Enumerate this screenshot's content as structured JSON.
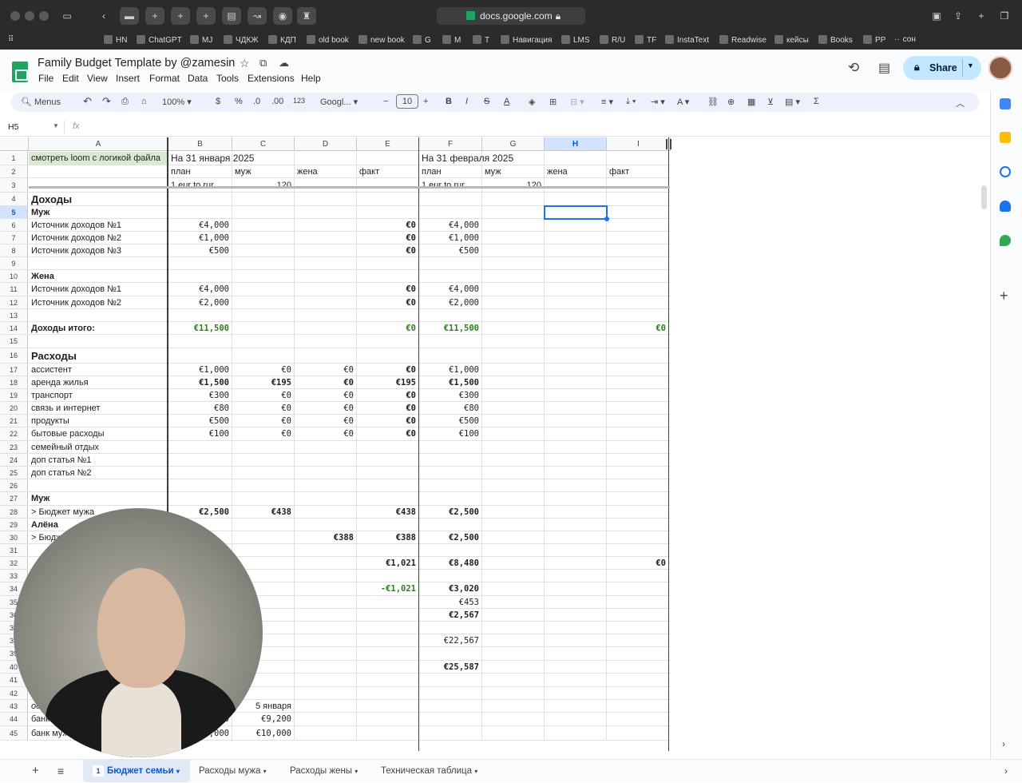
{
  "browser": {
    "url": "docs.google.com",
    "bookmarks": [
      "HN",
      "ChatGPT",
      "MJ",
      "ЧДКЖ",
      "КДП",
      "old book",
      "new book",
      "G",
      "M",
      "T",
      "Навигация",
      "LMS",
      "R/U",
      "TF",
      "InstaText",
      "Readwise",
      "кейсы",
      "Books",
      "PP",
      "сон"
    ]
  },
  "doc": {
    "title": "Family Budget Template by @zamesin",
    "menu": [
      "File",
      "Edit",
      "View",
      "Insert",
      "Format",
      "Data",
      "Tools",
      "Extensions",
      "Help"
    ],
    "share_label": "Share"
  },
  "toolbar": {
    "search": "Menus",
    "zoom": "100%",
    "currency": "$",
    "percent": "%",
    "dec_decrease": ".0",
    "dec_increase": ".00",
    "number_format": "123",
    "font": "Googl...",
    "font_size": "10",
    "bold": "B",
    "italic": "I",
    "strike": "S",
    "text_color": "A",
    "sum": "Σ"
  },
  "formula_bar": {
    "cell_ref": "H5",
    "fx": "fx",
    "value": ""
  },
  "columns": [
    "A",
    "B",
    "C",
    "D",
    "E",
    "F",
    "G",
    "H",
    "I"
  ],
  "selected_column": "H",
  "selected_row": "5",
  "rows": [
    {
      "n": "1",
      "cells": {
        "A": "смотреть loom с логикой файла",
        "B": "На 31 января 2025",
        "F": "На 31 февраля 2025"
      }
    },
    {
      "n": "2",
      "cells": {
        "B": "план",
        "C": "муж",
        "D": "жена",
        "E": "факт",
        "F": "план",
        "G": "муж",
        "H": "жена",
        "I": "факт"
      }
    },
    {
      "n": "3",
      "cells": {
        "B": "1 eur to rur",
        "C": "120",
        "F": "1 eur to rur",
        "G": "120"
      }
    },
    {
      "n": "4",
      "cells": {
        "A": "Доходы"
      }
    },
    {
      "n": "5",
      "cells": {
        "A": "Муж"
      }
    },
    {
      "n": "6",
      "cells": {
        "A": "Источник доходов №1",
        "B": "€4,000",
        "E": "€0",
        "F": "€4,000"
      }
    },
    {
      "n": "7",
      "cells": {
        "A": "Источник доходов №2",
        "B": "€1,000",
        "E": "€0",
        "F": "€1,000"
      }
    },
    {
      "n": "8",
      "cells": {
        "A": "Источник доходов №3",
        "B": "€500",
        "E": "€0",
        "F": "€500"
      }
    },
    {
      "n": "9",
      "cells": {}
    },
    {
      "n": "10",
      "cells": {
        "A": "Жена"
      }
    },
    {
      "n": "11",
      "cells": {
        "A": "Источник доходов №1",
        "B": "€4,000",
        "E": "€0",
        "F": "€4,000"
      }
    },
    {
      "n": "12",
      "cells": {
        "A": "Источник доходов №2",
        "B": "€2,000",
        "E": "€0",
        "F": "€2,000"
      }
    },
    {
      "n": "13",
      "cells": {}
    },
    {
      "n": "14",
      "cells": {
        "A": "Доходы итого:",
        "B": "€11,500",
        "E": "€0",
        "F": "€11,500",
        "I": "€0"
      }
    },
    {
      "n": "15",
      "cells": {}
    },
    {
      "n": "16",
      "cells": {
        "A": "Расходы"
      }
    },
    {
      "n": "17",
      "cells": {
        "A": "ассистент",
        "B": "€1,000",
        "C": "€0",
        "D": "€0",
        "E": "€0",
        "F": "€1,000"
      }
    },
    {
      "n": "18",
      "cells": {
        "A": "аренда жилья",
        "B": "€1,500",
        "C": "€195",
        "D": "€0",
        "E": "€195",
        "F": "€1,500"
      }
    },
    {
      "n": "19",
      "cells": {
        "A": "транспорт",
        "B": "€300",
        "C": "€0",
        "D": "€0",
        "E": "€0",
        "F": "€300"
      }
    },
    {
      "n": "20",
      "cells": {
        "A": "связь и интернет",
        "B": "€80",
        "C": "€0",
        "D": "€0",
        "E": "€0",
        "F": "€80"
      }
    },
    {
      "n": "21",
      "cells": {
        "A": "продукты",
        "B": "€500",
        "C": "€0",
        "D": "€0",
        "E": "€0",
        "F": "€500"
      }
    },
    {
      "n": "22",
      "cells": {
        "A": "бытовые расходы",
        "B": "€100",
        "C": "€0",
        "D": "€0",
        "E": "€0",
        "F": "€100"
      }
    },
    {
      "n": "23",
      "cells": {
        "A": "семейный отдых"
      }
    },
    {
      "n": "24",
      "cells": {
        "A": "доп статья №1"
      }
    },
    {
      "n": "25",
      "cells": {
        "A": "доп статья №2"
      }
    },
    {
      "n": "26",
      "cells": {}
    },
    {
      "n": "27",
      "cells": {
        "A": "Муж"
      }
    },
    {
      "n": "28",
      "cells": {
        "A": "> Бюджет мужа",
        "B": "€2,500",
        "C": "€438",
        "E": "€438",
        "F": "€2,500"
      }
    },
    {
      "n": "29",
      "cells": {
        "A": "Алёна"
      }
    },
    {
      "n": "30",
      "cells": {
        "A": "> Бюджет жены",
        "D": "€388",
        "E": "€388",
        "F": "€2,500"
      }
    },
    {
      "n": "31",
      "cells": {}
    },
    {
      "n": "32",
      "cells": {
        "E": "€1,021",
        "F": "€8,480",
        "I": "€0"
      }
    },
    {
      "n": "33",
      "cells": {}
    },
    {
      "n": "34",
      "cells": {
        "E": "-€1,021",
        "F": "€3,020"
      }
    },
    {
      "n": "35",
      "cells": {
        "F": "€453"
      }
    },
    {
      "n": "36",
      "cells": {
        "F": "€2,567"
      }
    },
    {
      "n": "37",
      "cells": {}
    },
    {
      "n": "38",
      "cells": {
        "F": "€22,567"
      }
    },
    {
      "n": "39",
      "cells": {}
    },
    {
      "n": "40",
      "cells": {
        "F": "€25,587"
      }
    },
    {
      "n": "41",
      "cells": {}
    },
    {
      "n": "42",
      "cells": {}
    },
    {
      "n": "43",
      "cells": {
        "A": "остатки",
        "C": "5 января"
      }
    },
    {
      "n": "44",
      "cells": {
        "A": "банк мужа",
        "B": "€9,000",
        "C": "€9,200"
      }
    },
    {
      "n": "45",
      "cells": {
        "A": "банк мужа 2",
        "B": "€10,000",
        "C": "€10,000"
      }
    }
  ],
  "sheet_tabs": [
    {
      "label": "Бюджет семьи",
      "badge": "1",
      "active": true
    },
    {
      "label": "Расходы мужа",
      "active": false
    },
    {
      "label": "Расходы жены",
      "active": false
    },
    {
      "label": "Техническая таблица",
      "active": false
    }
  ],
  "colors": {
    "accent": "#0b57d0",
    "share_bg": "#c2e7ff",
    "green": "#2d7d1f",
    "note_cell": "#d9ead3"
  }
}
